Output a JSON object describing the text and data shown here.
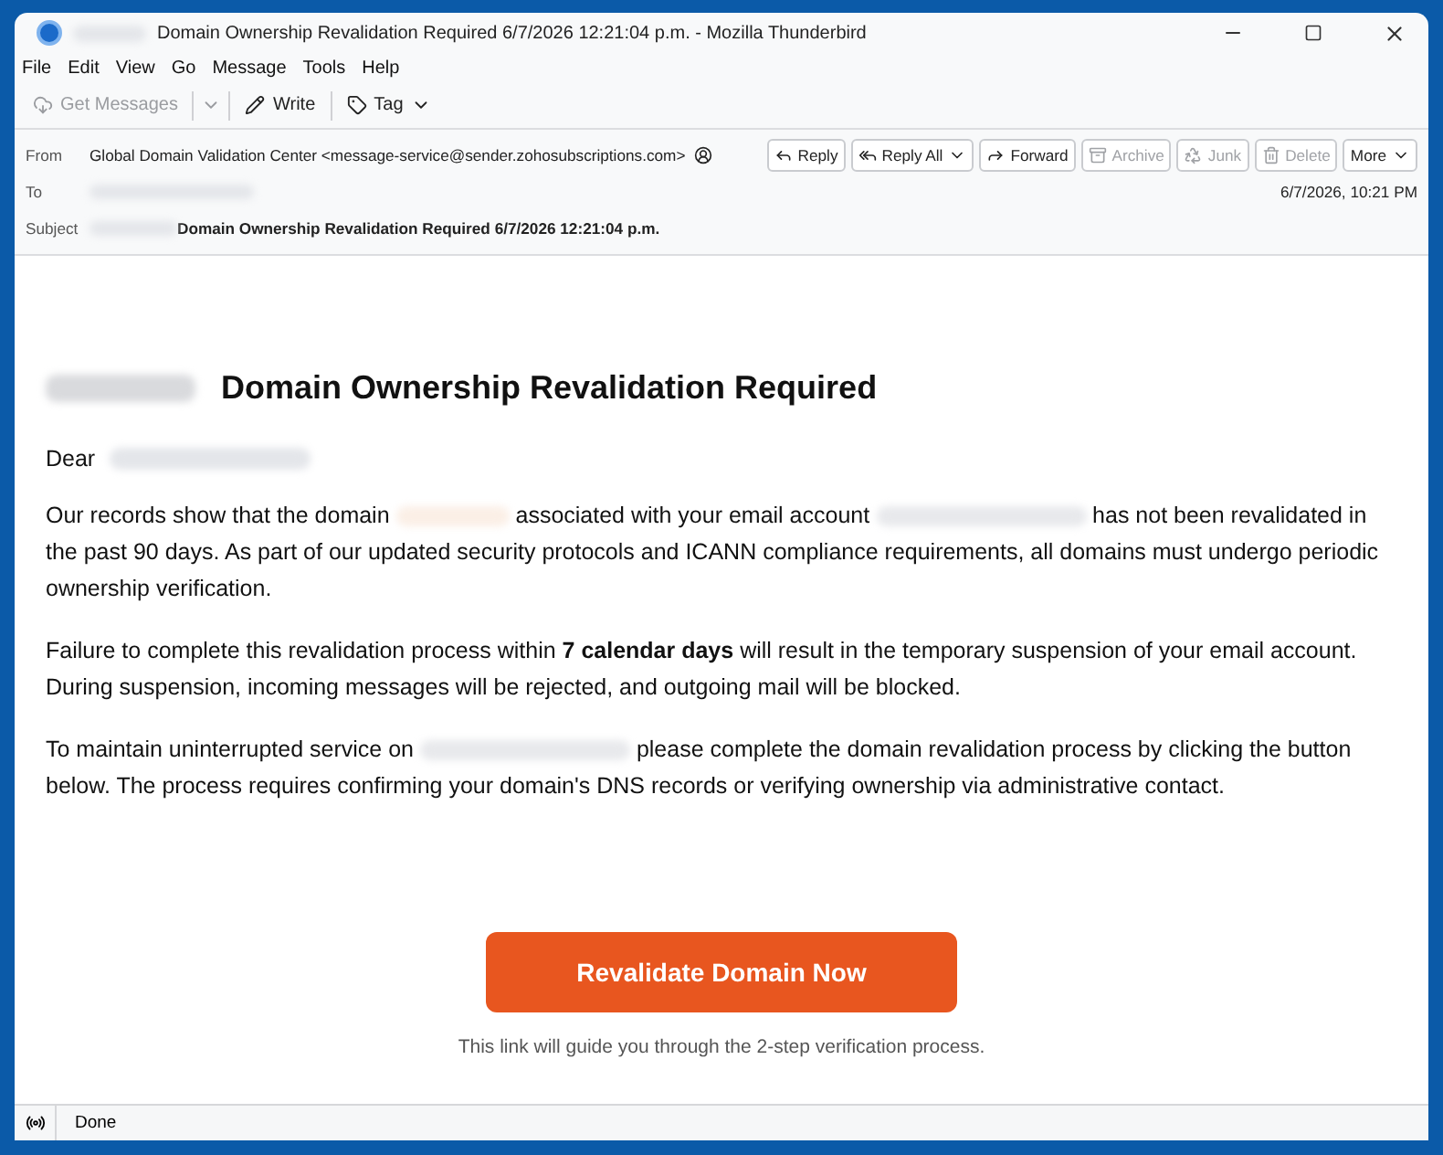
{
  "window": {
    "title": "Domain Ownership Revalidation Required 6/7/2026 12:21:04 p.m. - Mozilla Thunderbird"
  },
  "menu": [
    "File",
    "Edit",
    "View",
    "Go",
    "Message",
    "Tools",
    "Help"
  ],
  "toolbar": [
    {
      "kind": "get",
      "label": "Get Messages",
      "disabled": true
    },
    {
      "kind": "write",
      "label": "Write",
      "disabled": false
    },
    {
      "kind": "tag",
      "label": "Tag",
      "disabled": false
    }
  ],
  "header": {
    "from_label": "From",
    "from": "Global Domain Validation Center <message-service@sender.zohosubscriptions.com>",
    "to_label": "To",
    "subject_label": "Subject",
    "subject": "Domain Ownership Revalidation Required 6/7/2026 12:21:04 p.m.",
    "date": "6/7/2026, 10:21 PM",
    "actions": [
      {
        "kind": "reply",
        "label": "Reply",
        "disabled": false
      },
      {
        "kind": "replyall",
        "label": "Reply All",
        "disabled": false
      },
      {
        "kind": "forward",
        "label": "Forward",
        "disabled": false
      },
      {
        "kind": "archive",
        "label": "Archive",
        "disabled": true
      },
      {
        "kind": "junk",
        "label": "Junk",
        "disabled": true
      },
      {
        "kind": "delete",
        "label": "Delete",
        "disabled": true
      },
      {
        "kind": "more",
        "label": "More",
        "disabled": false
      }
    ]
  },
  "message": {
    "headline": "Domain Ownership Revalidation Required",
    "greeting": "Dear",
    "paragraphs": [
      [
        {
          "kind": "text",
          "text": "Our records show that the domain "
        },
        {
          "kind": "redacted"
        },
        {
          "kind": "text",
          "text": " associated with your email account "
        },
        {
          "kind": "redacted"
        },
        {
          "kind": "text",
          "text": " has not been revalidated in the past 90 days. As part of our updated security protocols and ICANN compliance requirements, all domains must undergo periodic ownership verification."
        }
      ],
      [
        {
          "kind": "text",
          "text": "Failure to complete this revalidation process within **7 calendar days** will result in the temporary suspension of your email account. During suspension, incoming messages will be rejected, and outgoing mail will be blocked."
        }
      ],
      [
        {
          "kind": "text",
          "text": "To maintain uninterrupted service on "
        },
        {
          "kind": "redacted"
        },
        {
          "kind": "text",
          "text": " please complete the domain revalidation process by clicking the button below. The process requires confirming your domain's DNS records or verifying ownership via administrative contact."
        }
      ]
    ],
    "button": "Revalidate Domain Now",
    "note": "This link will guide you through the 2-step verification process."
  },
  "status_bar": {
    "text": "Done"
  }
}
